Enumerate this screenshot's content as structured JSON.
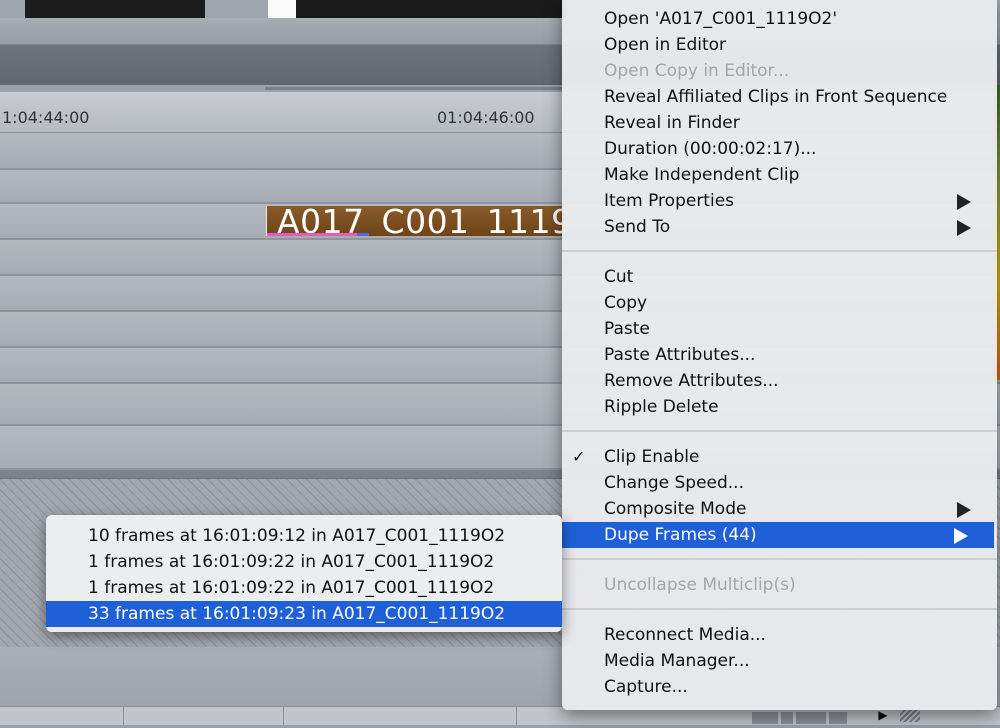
{
  "timeline": {
    "timecode_left": "1:04:44:00",
    "timecode_right": "01:04:46:00",
    "clip_name": "A017_C001_1119"
  },
  "context_menu": {
    "groups": [
      [
        {
          "label": "Open 'A017_C001_1119O2'",
          "enabled": true
        },
        {
          "label": "Open in Editor",
          "enabled": true
        },
        {
          "label": "Open Copy in Editor...",
          "enabled": false
        },
        {
          "label": "Reveal Affiliated Clips in Front Sequence",
          "enabled": true
        },
        {
          "label": "Reveal in Finder",
          "enabled": true
        },
        {
          "label": "Duration (00:00:02:17)...",
          "enabled": true
        },
        {
          "label": "Make Independent Clip",
          "enabled": true
        },
        {
          "label": "Item Properties",
          "enabled": true,
          "submenu": true
        },
        {
          "label": "Send To",
          "enabled": true,
          "submenu": true
        }
      ],
      [
        {
          "label": "Cut",
          "enabled": true
        },
        {
          "label": "Copy",
          "enabled": true
        },
        {
          "label": "Paste",
          "enabled": true
        },
        {
          "label": "Paste Attributes...",
          "enabled": true
        },
        {
          "label": "Remove Attributes...",
          "enabled": true
        },
        {
          "label": "Ripple Delete",
          "enabled": true
        }
      ],
      [
        {
          "label": "Clip Enable",
          "enabled": true,
          "checked": true
        },
        {
          "label": "Change Speed...",
          "enabled": true
        },
        {
          "label": "Composite Mode",
          "enabled": true,
          "submenu": true
        },
        {
          "label": "Dupe Frames (44)",
          "enabled": true,
          "submenu": true,
          "selected": true
        }
      ],
      [
        {
          "label": "Uncollapse Multiclip(s)",
          "enabled": false
        }
      ],
      [
        {
          "label": "Reconnect Media...",
          "enabled": true
        },
        {
          "label": "Media Manager...",
          "enabled": true
        },
        {
          "label": "Capture...",
          "enabled": true
        }
      ]
    ],
    "check_glyph": "✓"
  },
  "dupe_frames_submenu": [
    {
      "label": "10 frames at 16:01:09:12 in A017_C001_1119O2"
    },
    {
      "label": "1 frames at 16:01:09:22 in A017_C001_1119O2"
    },
    {
      "label": "1 frames at 16:01:09:22 in A017_C001_1119O2"
    },
    {
      "label": "33 frames at 16:01:09:23 in A017_C001_1119O2",
      "selected": true
    }
  ],
  "icons": {
    "play": "▶",
    "submenu_arrow": "triangle-right"
  },
  "colors": {
    "selection": "#1f60d8",
    "clip": "#7a4e22",
    "disabled_text": "#a3a6a9"
  }
}
